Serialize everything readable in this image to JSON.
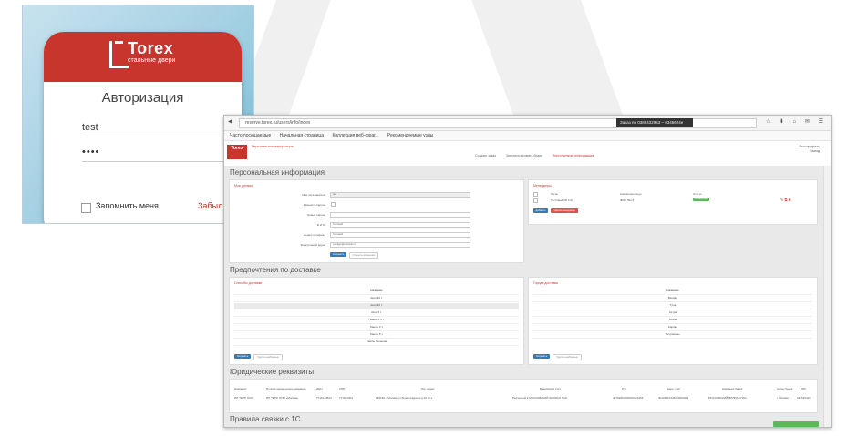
{
  "login": {
    "logo": "Torex",
    "logo_sub": "стальные двери",
    "title": "Авторизация",
    "username": "test",
    "password": "••••",
    "go_icon": "chevron-right-icon",
    "remember": "Запомнить меня",
    "forgot": "Забыли пароль?"
  },
  "browser": {
    "url": "reserve.torex.ru/users/info/index",
    "url_hidden": "Заказ по 0386432953 – 0345624е",
    "bookmarks": [
      "Часто посещаемые",
      "Начальная страница",
      "Коллекция веб-фраг...",
      "Рекомендуемые узлы"
    ]
  },
  "site": {
    "logo": "Torex",
    "crumb": "Персональная информация",
    "nav": [
      "Создать заказ",
      "Зарегистрировать бланк",
      "Персональная информация"
    ],
    "user": [
      "Ваш профиль",
      "Выход"
    ]
  },
  "sections": {
    "personal": "Персональная информация",
    "delivery": "Предпочтения по доставке",
    "legal": "Юридические реквизиты",
    "rules": "Правила связки с 1С"
  },
  "panels": {
    "my_data": "Мои данные",
    "managers": "Менеджеры",
    "delivery_methods": "Способы доставки",
    "delivery_cities": "Города доставки"
  },
  "form": {
    "labels": [
      "Имя пользователя",
      "Изменить пароль",
      "Новый пароль",
      "Ф.И.О.",
      "Номер телефона",
      "Электронный адрес"
    ],
    "values": [
      "test",
      "",
      "",
      "Тестовый",
      "Тестовый",
      "manager@example.ru"
    ],
    "save": "Сохранить",
    "cancel": "Отменить изменения"
  },
  "managers": {
    "cols": [
      "Логин",
      "Контактное лицо",
      "Статус"
    ],
    "row": [
      "Тестовый (ID 1/1)",
      "ФИО ТЕСТ",
      "Активирован"
    ],
    "add": "Добавить",
    "remove": "Удалить менеджера"
  },
  "delivery": {
    "header": "Название",
    "methods": [
      "Авто 20 т.",
      "Авто 10 т.",
      "Авто 5 т.",
      "Газель 1.5 т.",
      "Газель 3 т.",
      "Газель 5 т.",
      "Газель большая"
    ],
    "cities": [
      "Москва",
      "Тула",
      "Астра",
      "Атабй",
      "Кирова",
      "Астраханы"
    ],
    "save": "Сохранить",
    "reset": "Удалить выбранные"
  },
  "legal": {
    "cols": [
      "Название",
      "Полное юридическое название",
      "ИНН",
      "КПП",
      "Юр. адрес",
      "Банковский счёт",
      "Р/С",
      "Корр. счёт",
      "Название банка",
      "Адрес банка",
      "БИК"
    ],
    "row": [
      "ИП ТЕРР ООО",
      "ИП ТЕРР ООО «Москва»",
      "7716143824",
      "771601001",
      "125190, г.Москва ул.Ленинградская д.42 ст.1",
      "Расчетный в МОСКОВСКИЙ ФИЛИАЛ ПАО",
      "40702810000000123456",
      "30101810145250000411",
      "МОСКОВСКИЙ ФИЛИАЛ ПАО",
      "г. Москва",
      "044525411"
    ]
  }
}
